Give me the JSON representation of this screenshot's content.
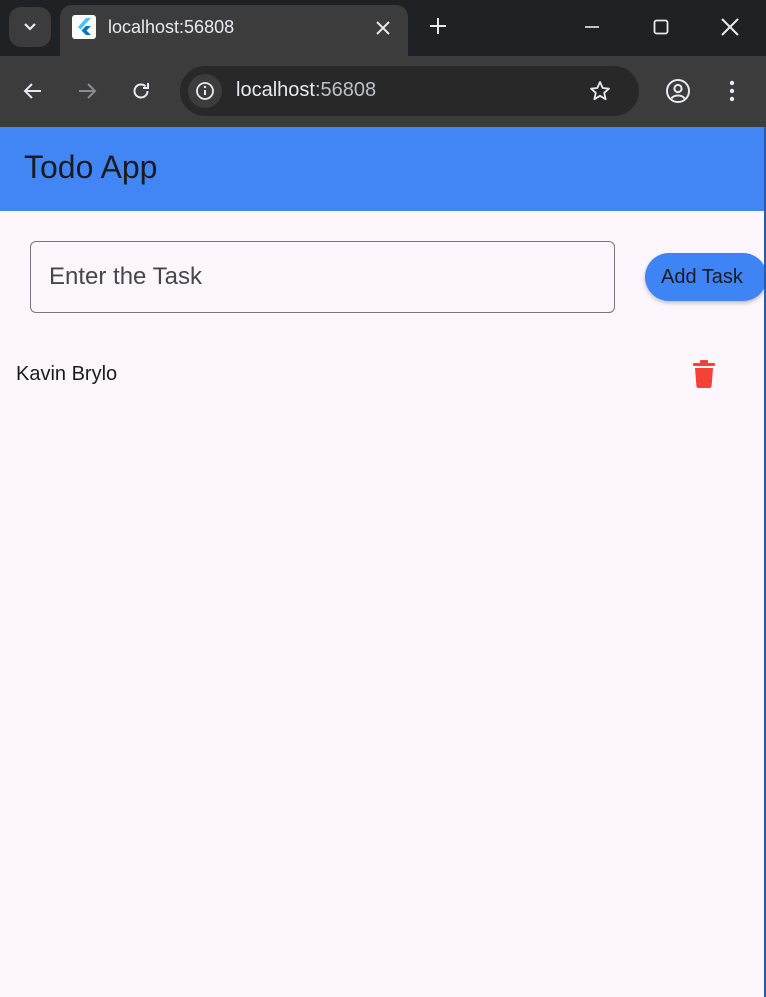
{
  "browser": {
    "tab_title": "localhost:56808",
    "url_host": "localhost",
    "url_port": ":56808",
    "accent": "#202124"
  },
  "app": {
    "title": "Todo App",
    "appbar_color": "#4286f6",
    "input_placeholder": "Enter the Task",
    "input_value": "",
    "add_button_label": "Add Task",
    "tasks": [
      {
        "text": "Kavin Brylo",
        "delete_icon": "trash-icon",
        "delete_color": "#f44336"
      }
    ]
  }
}
